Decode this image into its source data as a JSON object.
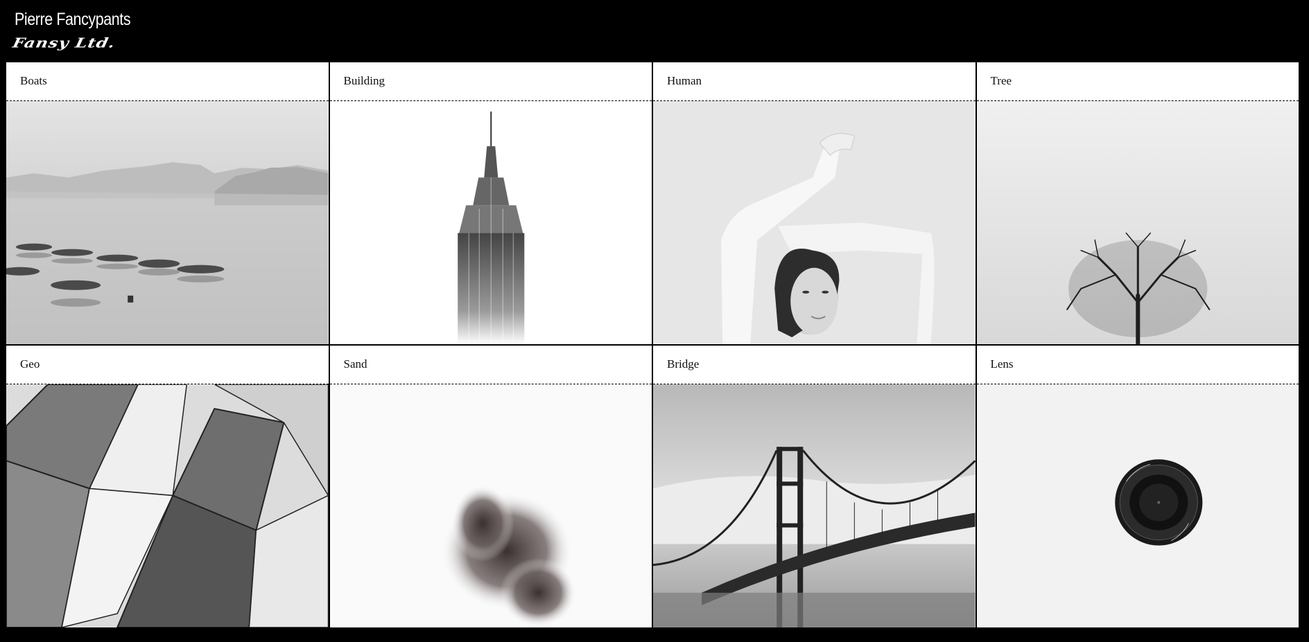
{
  "header": {
    "owner_name": "Pierre Fancypants",
    "company_name": "Fansy Ltd."
  },
  "gallery": {
    "items": [
      {
        "title": "Boats",
        "image": "boats-photo"
      },
      {
        "title": "Building",
        "image": "building-photo"
      },
      {
        "title": "Human",
        "image": "human-photo"
      },
      {
        "title": "Tree",
        "image": "tree-photo"
      },
      {
        "title": "Geo",
        "image": "geo-photo"
      },
      {
        "title": "Sand",
        "image": "sand-photo"
      },
      {
        "title": "Bridge",
        "image": "bridge-photo"
      },
      {
        "title": "Lens",
        "image": "lens-photo"
      }
    ]
  },
  "colors": {
    "background": "#000000",
    "card": "#ffffff",
    "text": "#111111"
  }
}
